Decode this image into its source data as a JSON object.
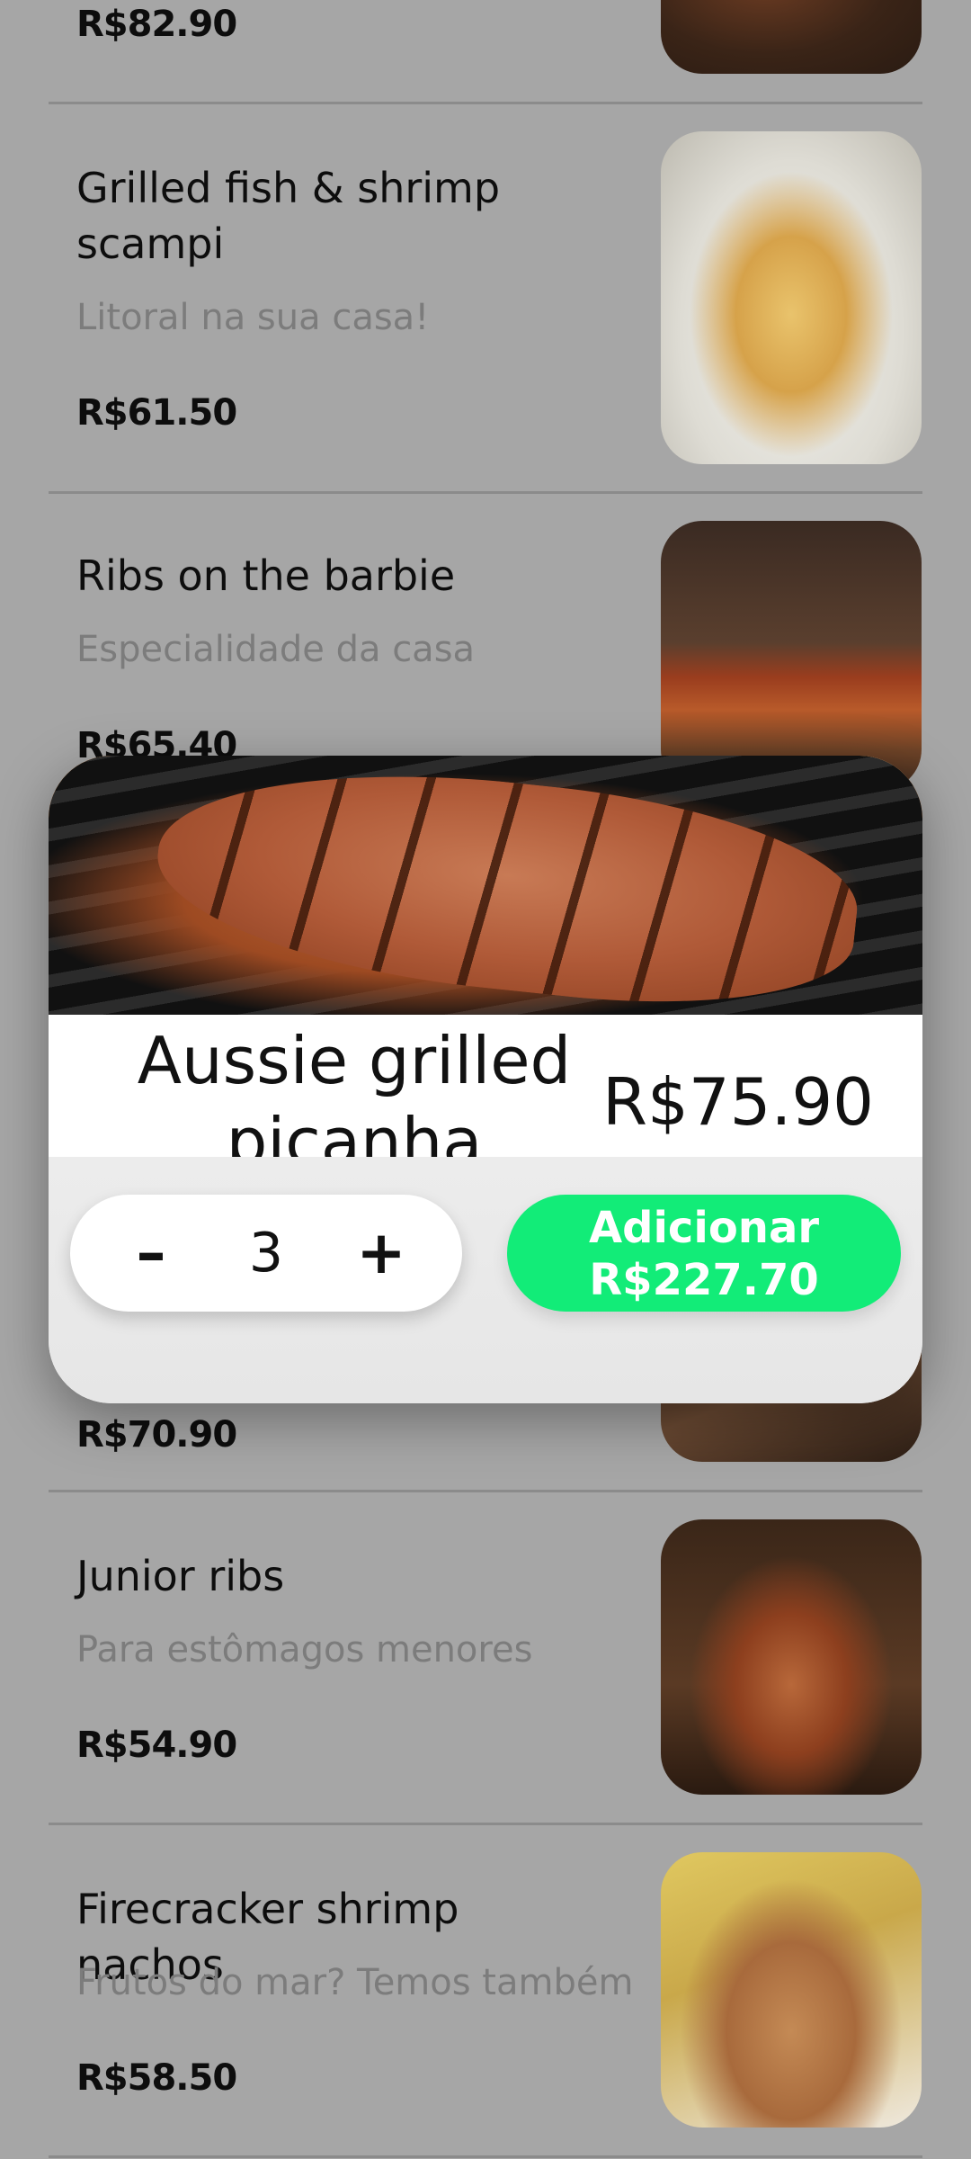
{
  "menu_items": [
    {
      "name": "",
      "description": "",
      "price": "R$82.90",
      "image_icon": "steak-photo"
    },
    {
      "name": "Grilled fish & shrimp scampi",
      "description": "Litoral na sua casa!",
      "price": "R$61.50",
      "image_icon": "fish-shrimp-photo"
    },
    {
      "name": "Ribs on the barbie",
      "description": "Especialidade da casa",
      "price": "R$65.40",
      "image_icon": "ribs-photo"
    },
    {
      "name": "",
      "description": "",
      "price": "R$70.90",
      "image_icon": "knife-board-photo"
    },
    {
      "name": "Junior ribs",
      "description": "Para estômagos menores",
      "price": "R$54.90",
      "image_icon": "junior-ribs-photo"
    },
    {
      "name": "Firecracker shrimp nachos",
      "description": "Frutos do mar? Temos também",
      "price": "R$58.50",
      "image_icon": "nachos-photo"
    }
  ],
  "modal": {
    "title": "Aussie grilled picanha",
    "price": "R$75.90",
    "image_icon": "picanha-grill-photo",
    "quantity": "3",
    "minus_label": "–",
    "plus_label": "+",
    "add_button_line1": "Adicionar",
    "add_button_line2": "R$227.70"
  },
  "colors": {
    "overlay_background": "#a6a6a6",
    "add_button": "#12ec78",
    "description_text": "#7c7c7c"
  }
}
